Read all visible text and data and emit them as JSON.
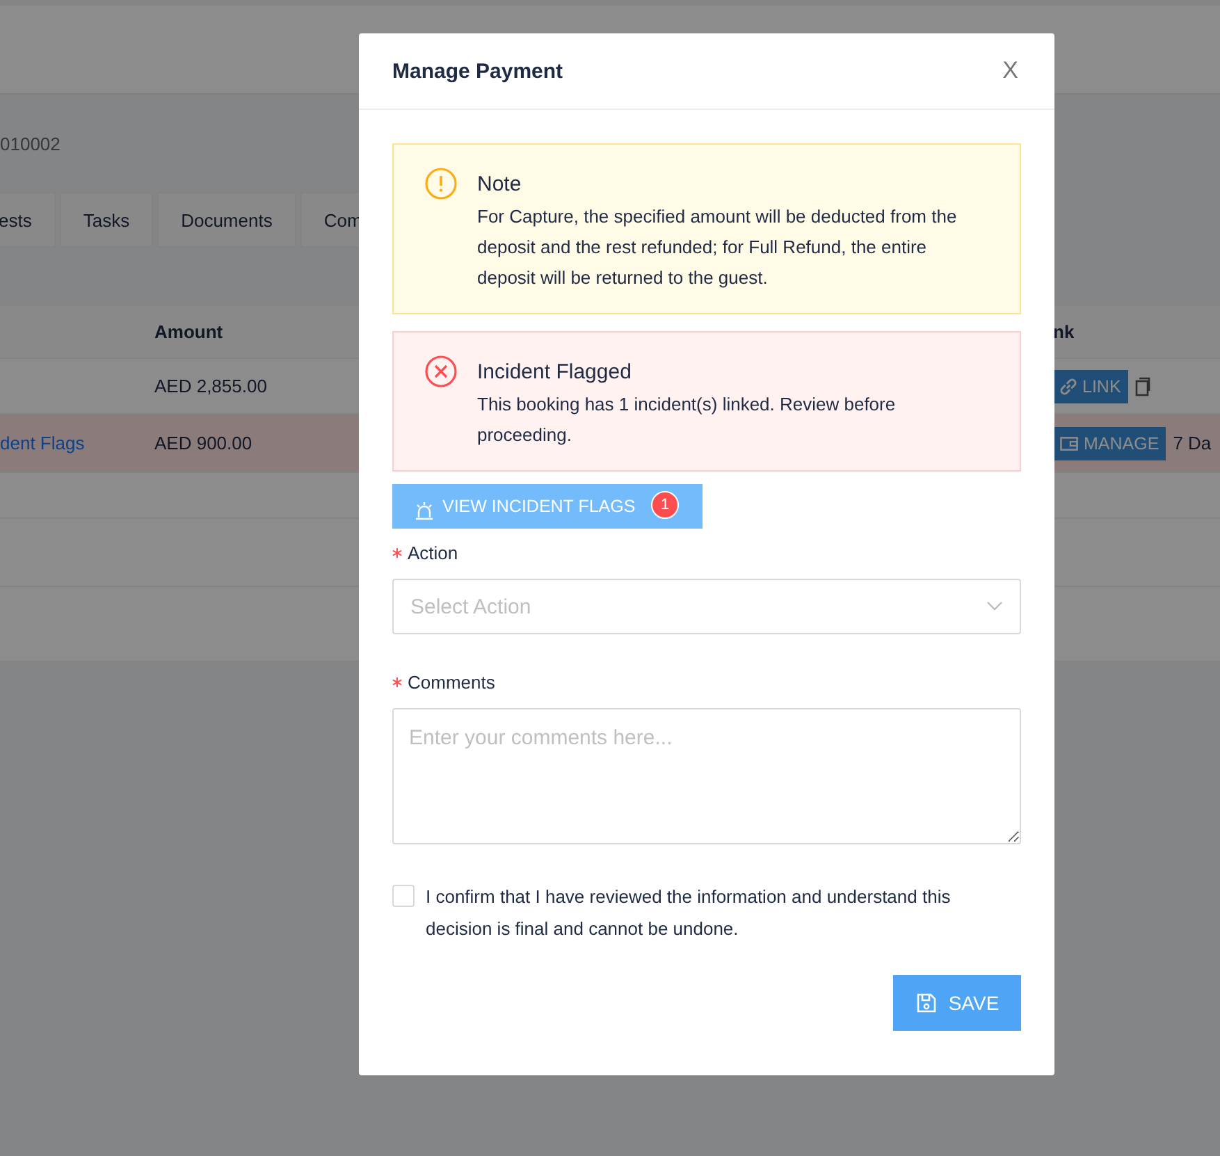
{
  "background_page": {
    "booking_id": "010002",
    "tabs": [
      {
        "label": "ests"
      },
      {
        "label": "Tasks"
      },
      {
        "label": "Documents"
      },
      {
        "label": "Com"
      }
    ],
    "table": {
      "columns": [
        "Amount",
        "nk"
      ],
      "rows": [
        {
          "flagged": false,
          "column_1": "",
          "amount": "AED 2,855.00",
          "action": {
            "kind": "link",
            "label": "LINK"
          },
          "column_4": ""
        },
        {
          "flagged": true,
          "column_1": "dent Flags",
          "amount": "AED 900.00",
          "action": {
            "kind": "manage",
            "label": "MANAGE"
          },
          "column_4": "7 Da"
        }
      ]
    }
  },
  "modal": {
    "title": "Manage Payment",
    "close": "X",
    "alerts": [
      {
        "kind": "warning",
        "title": "Note",
        "text": "For Capture, the specified amount will be deducted from the deposit and the rest refunded; for Full Refund, the entire deposit will be returned to the guest."
      },
      {
        "kind": "error",
        "title": "Incident Flagged",
        "text": "This booking has 1 incident(s) linked. Review before proceeding."
      }
    ],
    "incident_button": {
      "label": "VIEW INCIDENT FLAGS",
      "badge": "1"
    },
    "action_field": {
      "label": "Action",
      "required": true,
      "placeholder": "Select Action"
    },
    "comments_field": {
      "label": "Comments",
      "required": true,
      "placeholder": "Enter your comments here..."
    },
    "confirm": {
      "checked": false,
      "text": "I confirm that I have reviewed the information and understand this decision is final and cannot be undone."
    },
    "save_button": {
      "label": "SAVE"
    }
  }
}
